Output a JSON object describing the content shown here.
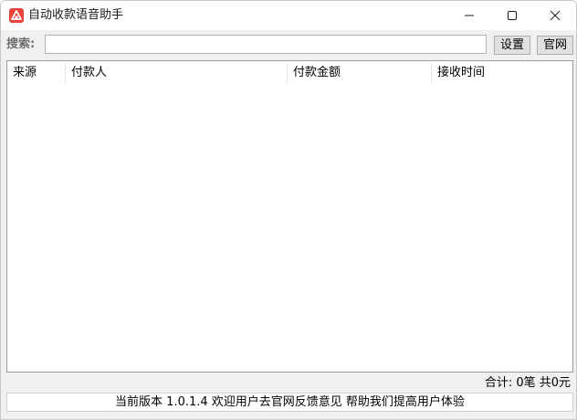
{
  "window": {
    "title": "自动收款语音助手"
  },
  "search": {
    "label": "搜索:",
    "value": "",
    "placeholder": ""
  },
  "buttons": {
    "settings": "设置",
    "website": "官网"
  },
  "table": {
    "columns": [
      "来源",
      "付款人",
      "付款金额",
      "接收时间"
    ],
    "rows": []
  },
  "summary": {
    "text": "合计: 0笔  共0元"
  },
  "statusbar": {
    "text": "当前版本 1.0.1.4 欢迎用户去官网反馈意见 帮助我们提高用户体验"
  },
  "colors": {
    "icon_red": "#e8443a",
    "window_bg": "#f0f0f0",
    "button_bg": "#e1e1e1"
  },
  "icons": {
    "app": "app-icon",
    "minimize": "minimize-icon",
    "maximize": "maximize-icon",
    "close": "close-icon"
  }
}
